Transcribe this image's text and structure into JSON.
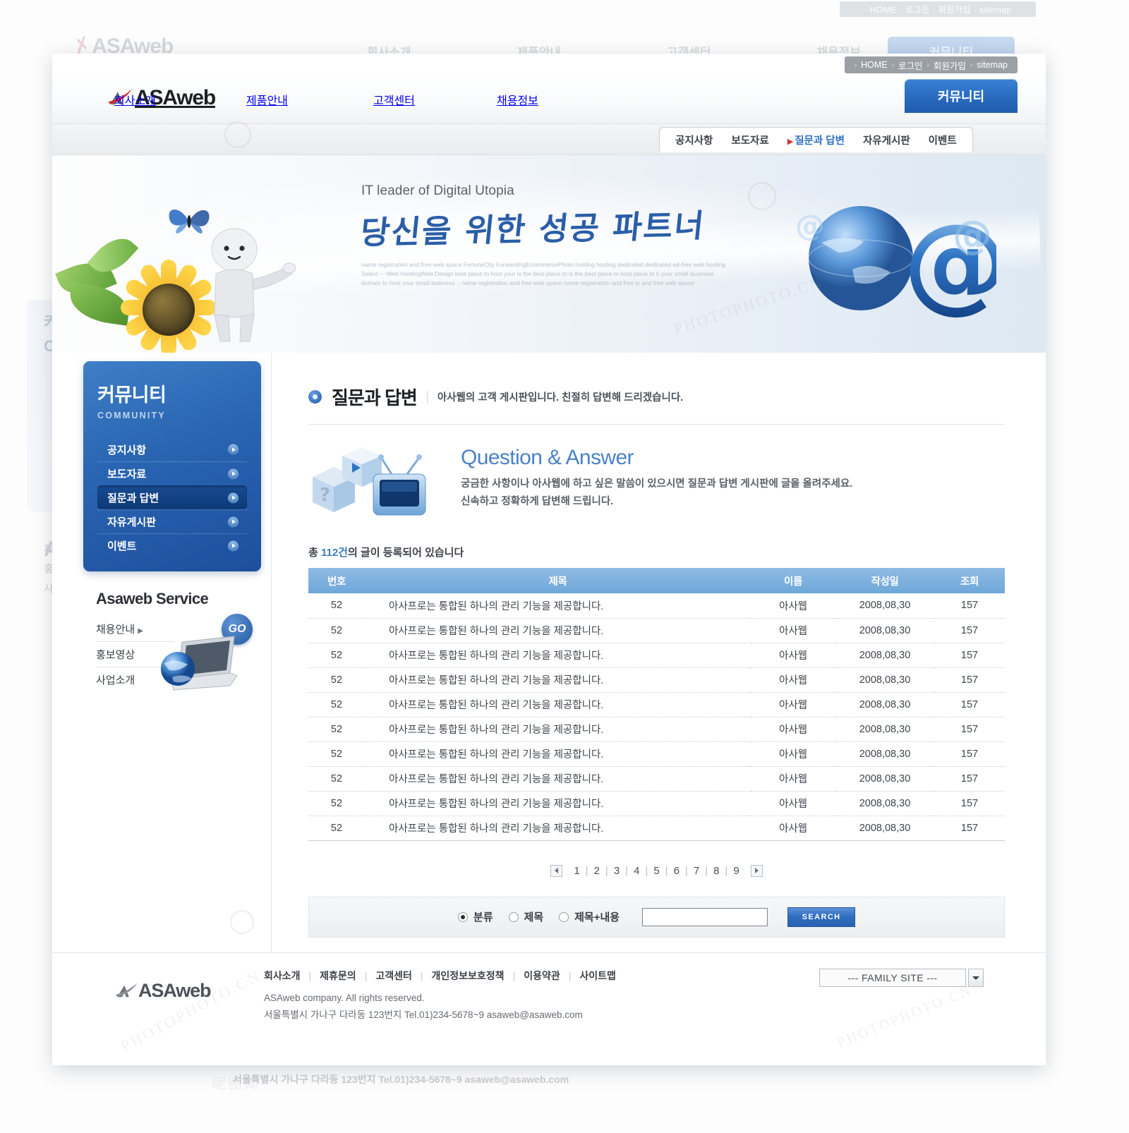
{
  "site": {
    "brand": "ASAweb",
    "brand_foot": "ASAweb"
  },
  "utility": {
    "items": [
      {
        "label": "HOME"
      },
      {
        "label": "로그인"
      },
      {
        "label": "회원가입"
      },
      {
        "label": "sitemap"
      }
    ],
    "ghost_text": "· HOME · 로그인 · 회원가입 · sitemap"
  },
  "mainnav": {
    "items": [
      {
        "label": "회사소개"
      },
      {
        "label": "제품안내"
      },
      {
        "label": "고객센터"
      },
      {
        "label": "채용정보"
      }
    ],
    "cta": {
      "label": "커뮤니티"
    }
  },
  "subnav": {
    "items": [
      {
        "label": "공지사항",
        "active": false
      },
      {
        "label": "보도자료",
        "active": false
      },
      {
        "label": "질문과 답변",
        "active": true
      },
      {
        "label": "자유게시판",
        "active": false
      },
      {
        "label": "이벤트",
        "active": false
      }
    ]
  },
  "hero": {
    "eyebrow": "IT leader of Digital Utopia",
    "slogan": "당신을 위한 성공 파트너",
    "fineprint": "name registration and free web space  FortuneCity ForwardingEcommercePhoto hosting hosting dedicated dedicated ad-free web hosting Select ~~Web HostingWeb Design  best place to host your is the best place to is the best place to host place to h your small business domain to host your small business :: name registration and free web space name registration and free in and free web space"
  },
  "sidebar": {
    "title": "커뮤니티",
    "subtitle": "COMMUNITY",
    "items": [
      {
        "label": "공지사항",
        "active": false
      },
      {
        "label": "보도자료",
        "active": false
      },
      {
        "label": "질문과 답변",
        "active": true
      },
      {
        "label": "자유게시판",
        "active": false
      },
      {
        "label": "이벤트",
        "active": false
      }
    ],
    "service": {
      "title": "Asaweb Service",
      "go_label": "GO",
      "links": [
        {
          "label": "채용안내",
          "arrow": true
        },
        {
          "label": "홍보영상",
          "arrow": false
        },
        {
          "label": "사업소개",
          "arrow": false
        }
      ]
    }
  },
  "main": {
    "page_title": "질문과 답변",
    "page_desc": "아사웹의 고객 게시판입니다. 친절히 답변해 드리겠습니다.",
    "qa": {
      "heading": "Question & Answer",
      "line1": "궁금한 사항이나 아사웹에 하고 싶은 말씀이 있으시면 질문과 답변 게시판에 글을 올려주세요.",
      "line2": "신속하고 정확하게 답변해 드립니다."
    },
    "count": {
      "prefix": "총 ",
      "number": "112건",
      "suffix": "의 글이 등록되어 있습니다"
    },
    "table": {
      "headers": [
        "번호",
        "제목",
        "이름",
        "작성일",
        "조회"
      ],
      "rows": [
        {
          "no": "52",
          "subject": "아사프로는 통합된 하나의 관리 기능을 제공합니다.",
          "name": "아사웹",
          "date": "2008,08,30",
          "hits": "157"
        },
        {
          "no": "52",
          "subject": "아사프로는 통합된 하나의 관리 기능을 제공합니다.",
          "name": "아사웹",
          "date": "2008,08,30",
          "hits": "157"
        },
        {
          "no": "52",
          "subject": "아사프로는 통합된 하나의 관리 기능을 제공합니다.",
          "name": "아사웹",
          "date": "2008,08,30",
          "hits": "157"
        },
        {
          "no": "52",
          "subject": "아사프로는 통합된 하나의 관리 기능을 제공합니다.",
          "name": "아사웹",
          "date": "2008,08,30",
          "hits": "157"
        },
        {
          "no": "52",
          "subject": "아사프로는 통합된 하나의 관리 기능을 제공합니다.",
          "name": "아사웹",
          "date": "2008,08,30",
          "hits": "157"
        },
        {
          "no": "52",
          "subject": "아사프로는 통합된 하나의 관리 기능을 제공합니다.",
          "name": "아사웹",
          "date": "2008,08,30",
          "hits": "157"
        },
        {
          "no": "52",
          "subject": "아사프로는 통합된 하나의 관리 기능을 제공합니다.",
          "name": "아사웹",
          "date": "2008,08,30",
          "hits": "157"
        },
        {
          "no": "52",
          "subject": "아사프로는 통합된 하나의 관리 기능을 제공합니다.",
          "name": "아사웹",
          "date": "2008,08,30",
          "hits": "157"
        },
        {
          "no": "52",
          "subject": "아사프로는 통합된 하나의 관리 기능을 제공합니다.",
          "name": "아사웹",
          "date": "2008,08,30",
          "hits": "157"
        },
        {
          "no": "52",
          "subject": "아사프로는 통합된 하나의 관리 기능을 제공합니다.",
          "name": "아사웹",
          "date": "2008,08,30",
          "hits": "157"
        }
      ]
    },
    "pager": {
      "pages": [
        "1",
        "2",
        "3",
        "4",
        "5",
        "6",
        "7",
        "8",
        "9"
      ],
      "prev_icon": "prev-arrow-icon",
      "next_icon": "next-arrow-icon"
    },
    "search": {
      "options": [
        {
          "label": "분류",
          "checked": true
        },
        {
          "label": "제목",
          "checked": false
        },
        {
          "label": "제목+내용",
          "checked": false
        }
      ],
      "value": "",
      "placeholder": "",
      "button_label": "SEARCH"
    }
  },
  "footer": {
    "links": [
      {
        "label": "회사소개"
      },
      {
        "label": "제휴문의"
      },
      {
        "label": "고객센터"
      },
      {
        "label": "개인정보보호정책"
      },
      {
        "label": "이용약관"
      },
      {
        "label": "사이트맵"
      }
    ],
    "copyright": "ASAweb company. All rights reserved.",
    "address": "서울특별시 가나구 다라동 123번지 Tel.01)234-5678~9 asaweb@asaweb.com",
    "family_site": "--- FAMILY SITE ---",
    "ghost_address": "서울특별시 가나구 다라동 123번지 Tel.01)234-5678~9 asaweb@asaweb.com"
  },
  "ghost": {
    "left_text": "치\n궁\n시",
    "a_letter": "A",
    "nav": [
      "회사소개",
      "제품안내",
      "고객센터",
      "채용정보"
    ],
    "cta": "커뮤니티"
  },
  "colors": {
    "accent_blue": "#2a66b3",
    "nav_cta": "#2a6cc0",
    "table_header": "#7fb2df",
    "qa_heading": "#4a82c8",
    "link_blue": "#3c7bc8",
    "red_dot": "#d0342c"
  }
}
